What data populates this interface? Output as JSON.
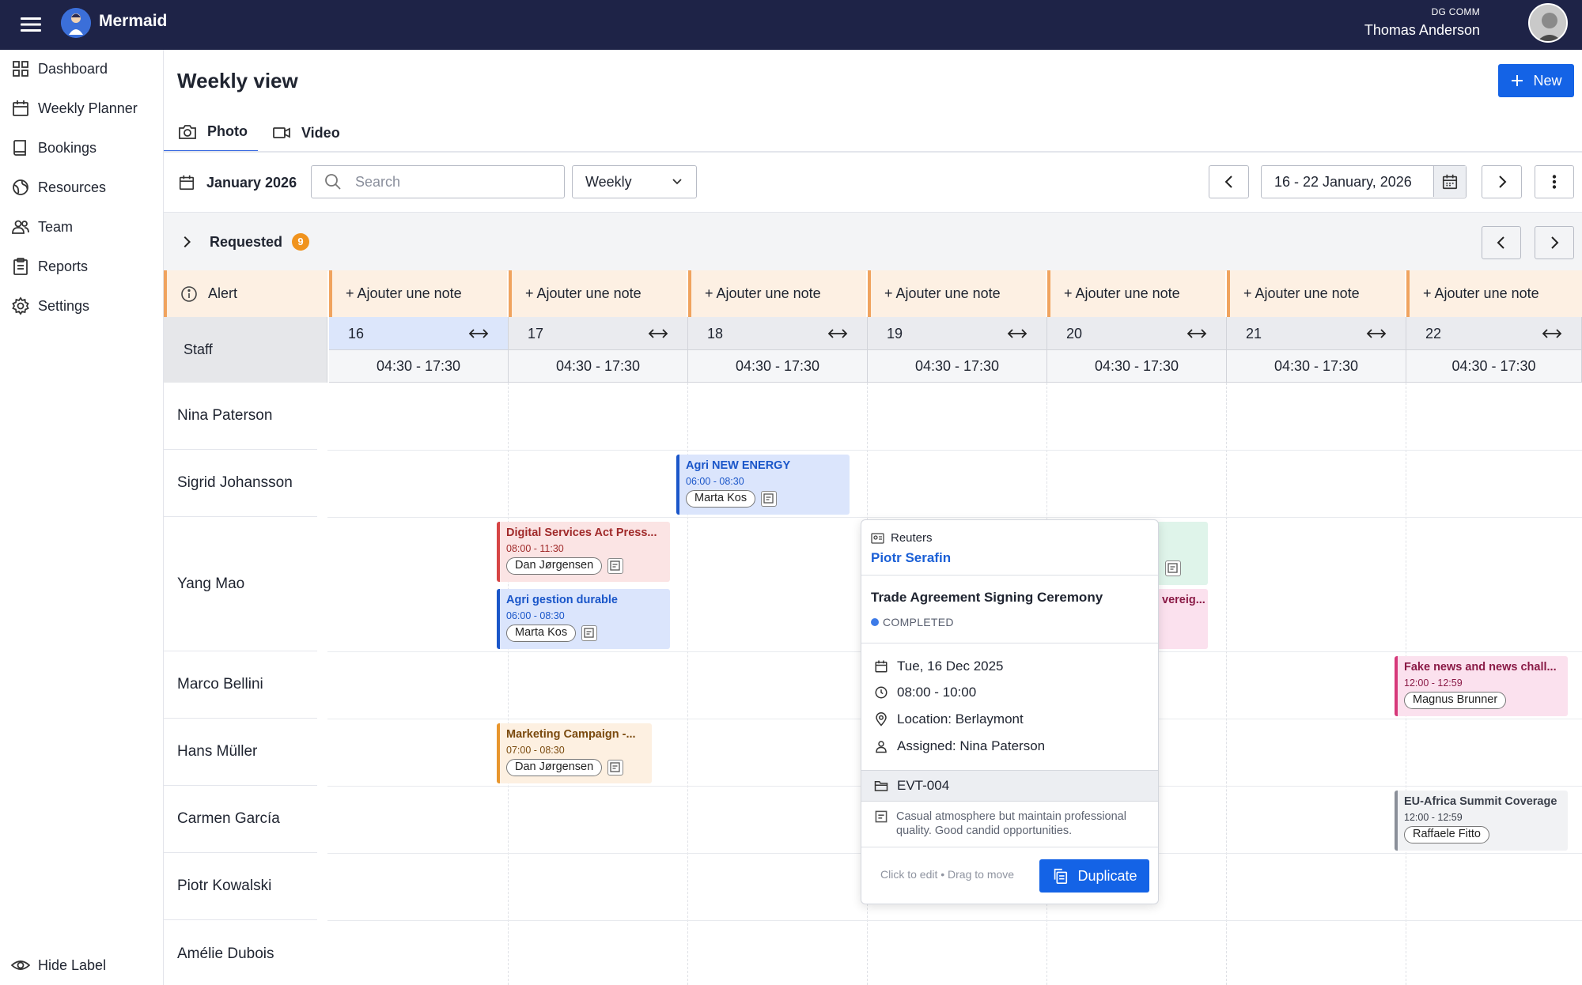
{
  "header": {
    "brand": "Mermaid",
    "org": "DG COMM",
    "user_name": "Thomas Anderson",
    "menu_icon": "hamburger-icon",
    "logo_icon": "mermaid-logo"
  },
  "sidebar": {
    "items": [
      {
        "label": "Dashboard",
        "icon": "grid-icon"
      },
      {
        "label": "Weekly Planner",
        "icon": "calendar-icon"
      },
      {
        "label": "Bookings",
        "icon": "book-icon"
      },
      {
        "label": "Resources",
        "icon": "globe-icon"
      },
      {
        "label": "Team",
        "icon": "users-icon"
      },
      {
        "label": "Reports",
        "icon": "clipboard-icon"
      },
      {
        "label": "Settings",
        "icon": "gear-icon"
      }
    ],
    "hide_label": "Hide Label"
  },
  "page": {
    "title": "Weekly view",
    "new_label": "New"
  },
  "tabs": [
    {
      "label": "Photo",
      "icon": "camera-icon",
      "active": true
    },
    {
      "label": "Video",
      "icon": "video-icon",
      "active": false
    }
  ],
  "toolbar": {
    "month": "January 2026",
    "search_placeholder": "Search",
    "view": "Weekly",
    "date_range": "16 - 22 January, 2026"
  },
  "requested": {
    "label": "Requested",
    "count": "9"
  },
  "grid": {
    "alert_label": "Alert",
    "note_label": "+ Ajouter une note",
    "staff_label": "Staff",
    "days": [
      {
        "num": "16",
        "hours": "04:30 - 17:30",
        "today": true
      },
      {
        "num": "17",
        "hours": "04:30 - 17:30"
      },
      {
        "num": "18",
        "hours": "04:30 - 17:30"
      },
      {
        "num": "19",
        "hours": "04:30 - 17:30"
      },
      {
        "num": "20",
        "hours": "04:30 - 17:30"
      },
      {
        "num": "21",
        "hours": "04:30 - 17:30"
      },
      {
        "num": "22",
        "hours": "04:30 - 17:30"
      }
    ],
    "staff": [
      "Nina Paterson",
      "Sigrid Johansson",
      "Yang Mao",
      "Marco Bellini",
      "Hans Müller",
      "Carmen García",
      "Piotr Kowalski",
      "Amélie Dubois"
    ]
  },
  "events": [
    {
      "title": "Agri NEW ENERGY",
      "time": "06:00 - 08:30",
      "person": "Marta Kos"
    },
    {
      "title": "Digital Services Act Press...",
      "time": "08:00 - 11:30",
      "person": "Dan Jørgensen"
    },
    {
      "title": "Agri gestion durable",
      "time": "06:00 - 08:30",
      "person": "Marta Kos"
    },
    {
      "title": "Marketing Campaign -...",
      "time": "07:00 - 08:30",
      "person": "Dan Jørgensen"
    },
    {
      "title": "Fake news and news chall...",
      "time": "12:00 - 12:59",
      "person": "Magnus Brunner"
    },
    {
      "title": "EU-Africa Summit Coverage",
      "time": "12:00 - 12:59",
      "person": "Raffaele Fitto"
    },
    {
      "title": "vereig..."
    }
  ],
  "popup": {
    "agency": "Reuters",
    "person": "Piotr Serafin",
    "title": "Trade Agreement Signing Ceremony",
    "status": "COMPLETED",
    "date": "Tue, 16 Dec 2025",
    "time": "08:00 - 10:00",
    "location": "Location: Berlaymont",
    "assigned": "Assigned: Nina Paterson",
    "ref": "EVT-004",
    "notes": "Casual atmosphere but maintain professional quality. Good candid opportunities.",
    "hint": "Click to edit • Drag to move",
    "duplicate_label": "Duplicate"
  },
  "colors": {
    "topbar": "#1e2347",
    "accent": "#1463e6",
    "note_bg": "#fdf0e3",
    "badge": "#f0931e",
    "event_blue": "#1a56c9",
    "event_red": "#d64545",
    "event_pink": "#d6397a",
    "event_orange": "#e8962d",
    "event_gray": "#8a8f99"
  }
}
